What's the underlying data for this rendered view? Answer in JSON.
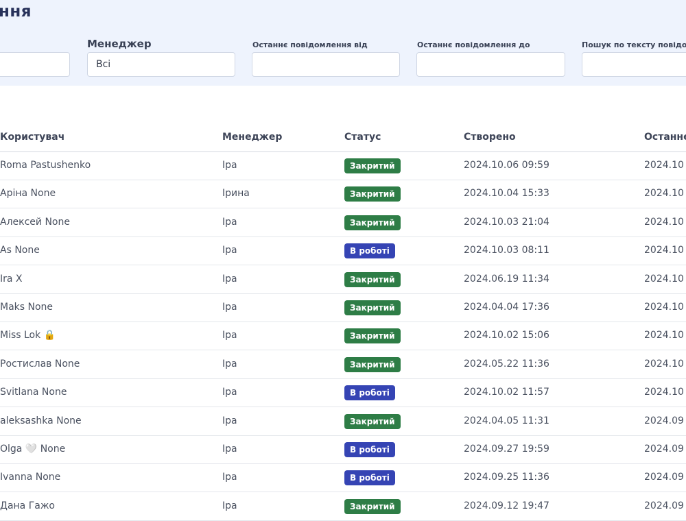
{
  "page_title": "ння",
  "filters": {
    "first_value": "",
    "manager_label": "Менеджер",
    "manager_value": "Всі",
    "last_from_label": "Останнє повідомлення від",
    "last_from_value": "",
    "last_to_label": "Останнє повідомлення до",
    "last_to_value": "",
    "search_label": "Пошук по тексту повідомле",
    "search_value": ""
  },
  "colors": {
    "panel_bg": "#eef3fd",
    "title": "#27315a",
    "status_closed": "#2e7d46",
    "status_in_work": "#3544b4"
  },
  "table": {
    "columns": [
      "Користувач",
      "Менеджер",
      "Статус",
      "Створено",
      "Останнє"
    ],
    "rows": [
      {
        "user": "Roma Pastushenko",
        "manager": "Іра",
        "status": "Закритий",
        "status_type": "closed",
        "created": "2024.10.06 09:59",
        "last": "2024.10"
      },
      {
        "user": "Аріна None",
        "manager": "Ірина",
        "status": "Закритий",
        "status_type": "closed",
        "created": "2024.10.04 15:33",
        "last": "2024.10"
      },
      {
        "user": "Алексей None",
        "manager": "Іра",
        "status": "Закритий",
        "status_type": "closed",
        "created": "2024.10.03 21:04",
        "last": "2024.10"
      },
      {
        "user": "As None",
        "manager": "Іра",
        "status": "В роботі",
        "status_type": "work",
        "created": "2024.10.03 08:11",
        "last": "2024.10"
      },
      {
        "user": "Ira X",
        "manager": "Іра",
        "status": "Закритий",
        "status_type": "closed",
        "created": "2024.06.19 11:34",
        "last": "2024.10"
      },
      {
        "user": "Maks None",
        "manager": "Іра",
        "status": "Закритий",
        "status_type": "closed",
        "created": "2024.04.04 17:36",
        "last": "2024.10"
      },
      {
        "user": "Miss Lok 🔒",
        "manager": "Іра",
        "status": "Закритий",
        "status_type": "closed",
        "created": "2024.10.02 15:06",
        "last": "2024.10"
      },
      {
        "user": "Ростислав None",
        "manager": "Іра",
        "status": "Закритий",
        "status_type": "closed",
        "created": "2024.05.22 11:36",
        "last": "2024.10"
      },
      {
        "user": "Svitlana None",
        "manager": "Іра",
        "status": "В роботі",
        "status_type": "work",
        "created": "2024.10.02 11:57",
        "last": "2024.10"
      },
      {
        "user": "aleksashka None",
        "manager": "Іра",
        "status": "Закритий",
        "status_type": "closed",
        "created": "2024.04.05 11:31",
        "last": "2024.09"
      },
      {
        "user": "Olga 🤍 None",
        "manager": "Іра",
        "status": "В роботі",
        "status_type": "work",
        "created": "2024.09.27 19:59",
        "last": "2024.09"
      },
      {
        "user": "Ivanna None",
        "manager": "Іра",
        "status": "В роботі",
        "status_type": "work",
        "created": "2024.09.25 11:36",
        "last": "2024.09"
      },
      {
        "user": "Дана Гажо",
        "manager": "Іра",
        "status": "Закритий",
        "status_type": "closed",
        "created": "2024.09.12 19:47",
        "last": "2024.09"
      }
    ]
  }
}
